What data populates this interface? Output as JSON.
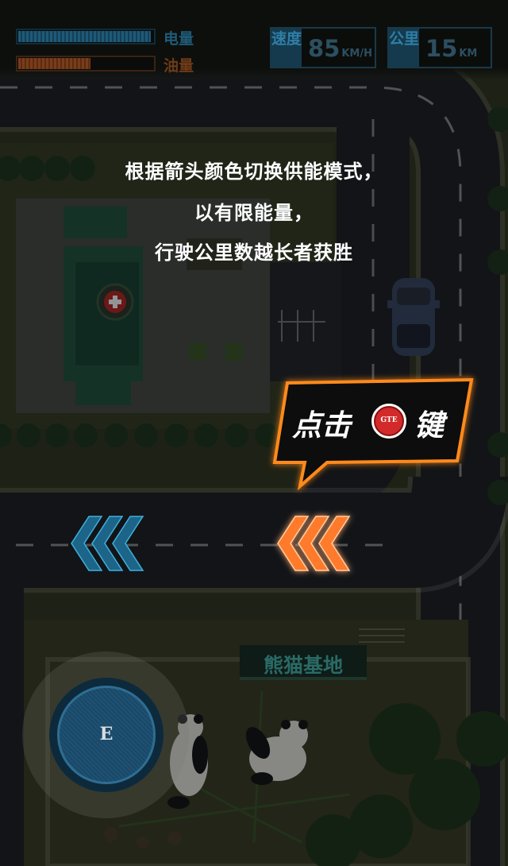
{
  "hud": {
    "energy": {
      "label": "电量",
      "level": 0.98
    },
    "fuel": {
      "label": "油量",
      "level": 0.54
    },
    "speed": {
      "tag": "速度",
      "value": "85",
      "unit": "KM/H"
    },
    "distance": {
      "tag": "公里",
      "value": "15",
      "unit": "KM"
    }
  },
  "instructions": {
    "line1": "根据箭头颜色切换供能模式，",
    "line2": "以有限能量，",
    "line3": "行驶公里数越长者获胜"
  },
  "callout": {
    "prefix": "点击",
    "button_label": "GTE",
    "suffix": "键"
  },
  "landmarks": {
    "panda_base": "熊猫基地"
  },
  "joystick": {
    "label": "E"
  },
  "colors": {
    "road": "#22252a",
    "grass": "#3b4128",
    "energy_arrow": "#1f6c8f",
    "fuel_arrow": "#ff7a2a",
    "callout_glow": "#ff8a1e",
    "gte_red": "#d22a2a"
  }
}
